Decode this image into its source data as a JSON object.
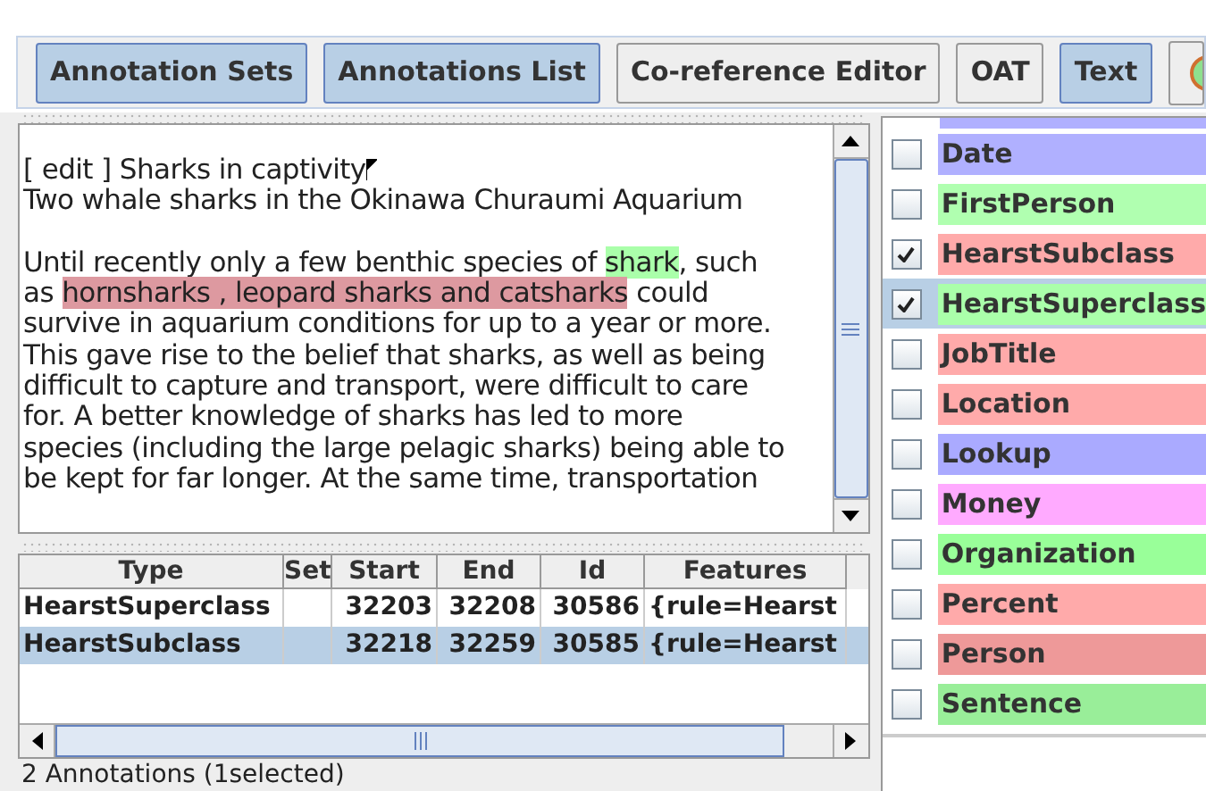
{
  "toolbar": {
    "buttons": [
      {
        "kind": "text",
        "label": "Annotation Sets",
        "selected": true
      },
      {
        "kind": "text",
        "label": "Annotations List",
        "selected": true
      },
      {
        "kind": "text",
        "label": "Co-reference Editor",
        "selected": false
      },
      {
        "kind": "text",
        "label": "OAT",
        "selected": false
      },
      {
        "kind": "text",
        "label": "Text",
        "selected": true
      },
      {
        "kind": "icon",
        "selected": false
      }
    ]
  },
  "text_view": {
    "paragraphs": [
      [
        [
          {
            "text": "[ edit ] Sharks in captivity",
            "cursor": true
          }
        ],
        [
          {
            "text": "Two whale sharks in the Okinawa Churaumi Aquarium"
          }
        ]
      ],
      [
        [
          {
            "text": "Until recently only a few benthic species of "
          },
          {
            "text": "shark",
            "color": "#aaffaa"
          },
          {
            "text": ", such"
          }
        ],
        [
          {
            "text": "as "
          },
          {
            "text": "hornsharks , leopard sharks and catsharks",
            "color": "#dd99a0"
          },
          {
            "text": " could"
          }
        ],
        [
          {
            "text": "survive in aquarium conditions for up to a year or more."
          }
        ],
        [
          {
            "text": "This gave rise to the belief that sharks, as well as being"
          }
        ],
        [
          {
            "text": "difficult to capture and transport, were difficult to care"
          }
        ],
        [
          {
            "text": "for. A better knowledge of sharks has led to more"
          }
        ],
        [
          {
            "text": "species (including the large pelagic sharks) being able to"
          }
        ],
        [
          {
            "text": "be kept for far longer. At the same time, transportation"
          }
        ]
      ]
    ]
  },
  "table": {
    "columns": [
      "Type",
      "Set",
      "Start",
      "End",
      "Id",
      "Features"
    ],
    "rows": [
      {
        "cells": [
          "HearstSuperclass",
          "",
          "32203",
          "32208",
          "30586",
          "{rule=Hearst"
        ],
        "selected": false
      },
      {
        "cells": [
          "HearstSubclass",
          "",
          "32218",
          "32259",
          "30585",
          "{rule=Hearst"
        ],
        "selected": true
      }
    ]
  },
  "status_bar": "2 Annotations (1selected)",
  "annotation_types": [
    {
      "name": "Date",
      "checked": false,
      "selected": false,
      "color": "#b0b0ff"
    },
    {
      "name": "FirstPerson",
      "checked": false,
      "selected": false,
      "color": "#b0ffb0"
    },
    {
      "name": "HearstSubclass",
      "checked": true,
      "selected": false,
      "color": "#ffaaaa"
    },
    {
      "name": "HearstSuperclass",
      "checked": true,
      "selected": true,
      "color": "#aaffaa"
    },
    {
      "name": "JobTitle",
      "checked": false,
      "selected": false,
      "color": "#ffaaaa"
    },
    {
      "name": "Location",
      "checked": false,
      "selected": false,
      "color": "#ffaaaa"
    },
    {
      "name": "Lookup",
      "checked": false,
      "selected": false,
      "color": "#aaaaff"
    },
    {
      "name": "Money",
      "checked": false,
      "selected": false,
      "color": "#ffaaff"
    },
    {
      "name": "Organization",
      "checked": false,
      "selected": false,
      "color": "#99ff99"
    },
    {
      "name": "Percent",
      "checked": false,
      "selected": false,
      "color": "#ffaaaa"
    },
    {
      "name": "Person",
      "checked": false,
      "selected": false,
      "color": "#ee9999"
    },
    {
      "name": "Sentence",
      "checked": false,
      "selected": false,
      "color": "#99ee99"
    }
  ]
}
